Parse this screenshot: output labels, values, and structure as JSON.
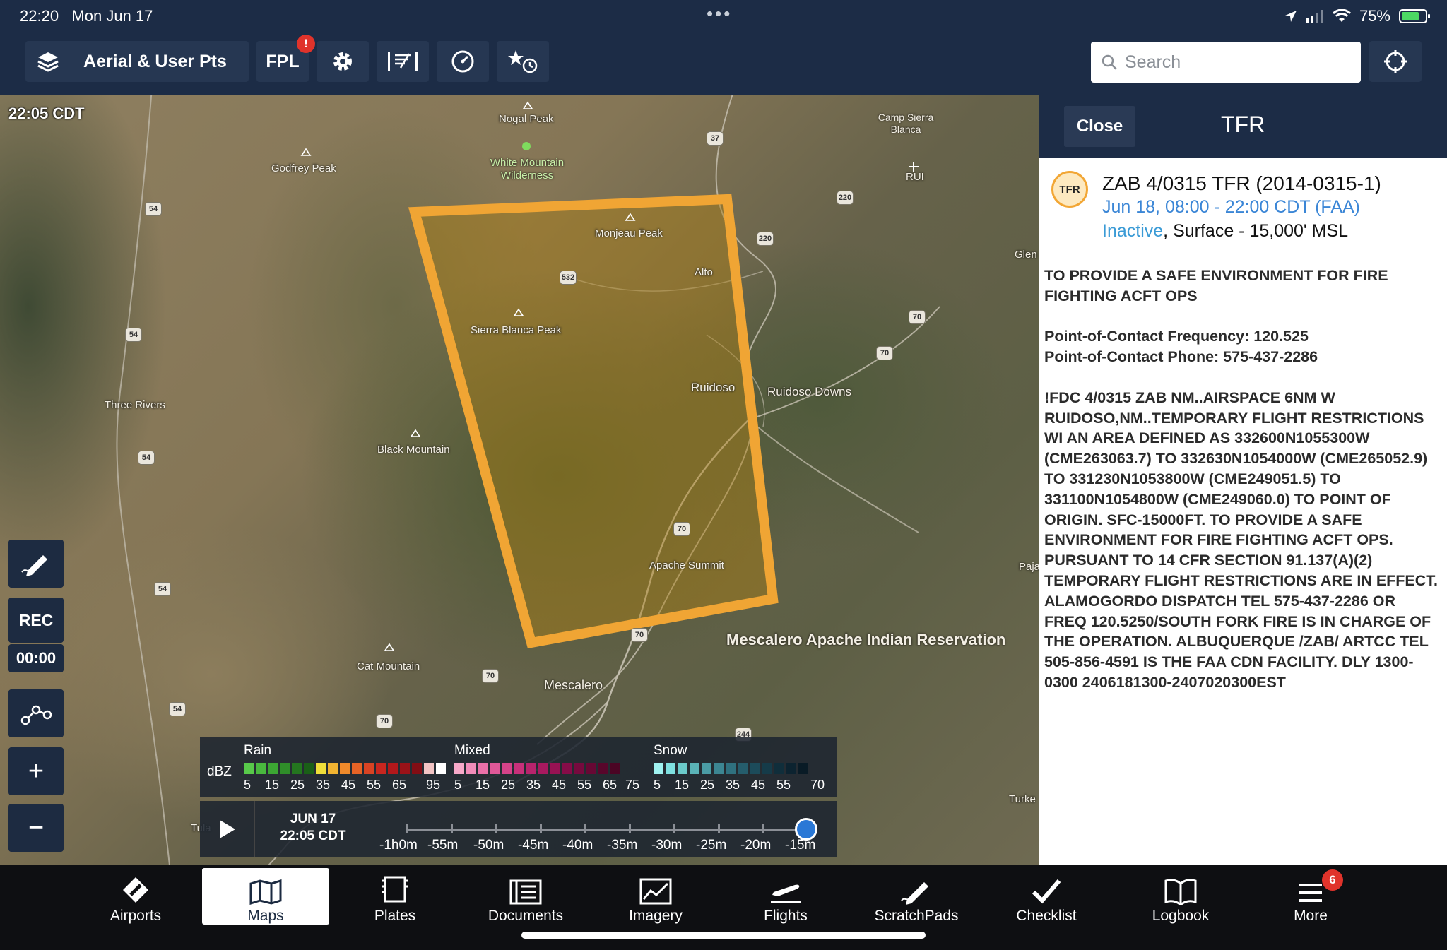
{
  "status_bar": {
    "time": "22:20",
    "date": "Mon Jun 17",
    "battery": "75%",
    "battery_level": 0.75
  },
  "toolbar": {
    "layer_label": "Aerial & User Pts",
    "fpl_label": "FPL",
    "fpl_badge": "!",
    "search_placeholder": "Search"
  },
  "map": {
    "timestamp": "22:05 CDT",
    "labels": [
      {
        "text": "Nogal Peak"
      },
      {
        "text": "White Mountain Wilderness"
      },
      {
        "text": "Godfrey Peak"
      },
      {
        "text": "Camp Sierra Blanca"
      },
      {
        "text": "RUI"
      },
      {
        "text": "Monjeau Peak"
      },
      {
        "text": "Alto"
      },
      {
        "text": "Sierra Blanca Peak"
      },
      {
        "text": "Ruidoso"
      },
      {
        "text": "Ruidoso Downs"
      },
      {
        "text": "Three Rivers"
      },
      {
        "text": "Black Mountain"
      },
      {
        "text": "Apache Summit"
      },
      {
        "text": "Cat Mountain"
      },
      {
        "text": "Mescalero"
      },
      {
        "text": "Glen"
      },
      {
        "text": "Paja"
      },
      {
        "text": "Turke"
      },
      {
        "text": "Tula"
      }
    ],
    "reservation_label": "Mescalero Apache Indian Reservation",
    "route_shields": [
      "37",
      "220",
      "220",
      "532",
      "70",
      "70",
      "70",
      "70",
      "70",
      "70",
      "54",
      "54",
      "54",
      "54",
      "54",
      "244"
    ]
  },
  "side_controls": {
    "rec_label": "REC",
    "rec_timer": "00:00",
    "zoom_in": "+",
    "zoom_out": "−"
  },
  "radar_legend": {
    "unit": "dBZ",
    "rain_label": "Rain",
    "mixed_label": "Mixed",
    "snow_label": "Snow",
    "rain_ticks": [
      "5",
      "15",
      "25",
      "35",
      "45",
      "55",
      "65",
      "95"
    ],
    "mixed_ticks": [
      "5",
      "15",
      "25",
      "35",
      "45",
      "55",
      "65",
      "75"
    ],
    "snow_ticks": [
      "5",
      "15",
      "25",
      "35",
      "45",
      "55",
      "70"
    ],
    "rain_colors": [
      "#58c94a",
      "#49b83e",
      "#3ca633",
      "#2f8d29",
      "#24761f",
      "#1a5f17",
      "#f0de3a",
      "#f2b431",
      "#ef8a2b",
      "#e66326",
      "#d94323",
      "#c8261f",
      "#b2181b",
      "#9a1218",
      "#820d14",
      "#f2c4c4",
      "#ffffff"
    ],
    "mixed_colors": [
      "#f7a9c9",
      "#f18cb9",
      "#ea70a8",
      "#e05898",
      "#d54389",
      "#c8307a",
      "#b8236c",
      "#a8195f",
      "#971253",
      "#860c48",
      "#760a3e",
      "#670834",
      "#58062b",
      "#4b0524"
    ],
    "snow_colors": [
      "#9ff2f0",
      "#7fe0e0",
      "#6bcaca",
      "#5ab3b7",
      "#4a9ca5",
      "#3c8692",
      "#2f717f",
      "#255d6c",
      "#1c4b5a",
      "#153b49",
      "#102e3b",
      "#0c2330",
      "#091b26"
    ]
  },
  "timeline": {
    "date": "JUN 17",
    "time": "22:05 CDT",
    "labels": [
      "-1h0m",
      "-55m",
      "-50m",
      "-45m",
      "-40m",
      "-35m",
      "-30m",
      "-25m",
      "-20m",
      "-15m"
    ],
    "position": 1.0
  },
  "tfr_panel": {
    "close_label": "Close",
    "title": "TFR",
    "icon_text": "TFR",
    "name": "ZAB 4/0315 TFR (2014-0315-1)",
    "time_range": "Jun 18, 08:00 - 22:00 CDT (FAA)",
    "status": "Inactive",
    "altitude": ", Surface - 15,000' MSL",
    "description": "TO PROVIDE A SAFE ENVIRONMENT FOR FIRE FIGHTING ACFT OPS\n\nPoint-of-Contact Frequency: 120.525\nPoint-of-Contact Phone: 575-437-2286\n\n!FDC 4/0315 ZAB NM..AIRSPACE 6NM W RUIDOSO,NM..TEMPORARY FLIGHT RESTRICTIONS WI AN AREA DEFINED AS 332600N1055300W (CME263063.7) TO 332630N1054000W (CME265052.9) TO 331230N1053800W (CME249051.5) TO 331100N1054800W (CME249060.0) TO POINT OF ORIGIN. SFC-15000FT. TO PROVIDE A SAFE ENVIRONMENT FOR FIRE FIGHTING ACFT OPS. PURSUANT TO 14 CFR SECTION 91.137(A)(2) TEMPORARY FLIGHT RESTRICTIONS ARE IN EFFECT. ALAMOGORDO DISPATCH TEL 575-437-2286 OR FREQ 120.5250/SOUTH FORK FIRE IS IN CHARGE OF THE OPERATION. ALBUQUERQUE /ZAB/ ARTCC TEL 505-856-4591 IS THE FAA CDN FACILITY. DLY 1300-0300 2406181300-2407020300EST"
  },
  "tabbar": {
    "tabs": [
      {
        "label": "Airports",
        "icon": "airports-icon"
      },
      {
        "label": "Maps",
        "icon": "maps-icon",
        "active": true
      },
      {
        "label": "Plates",
        "icon": "plates-icon"
      },
      {
        "label": "Documents",
        "icon": "documents-icon"
      },
      {
        "label": "Imagery",
        "icon": "imagery-icon"
      },
      {
        "label": "Flights",
        "icon": "flights-icon"
      },
      {
        "label": "ScratchPads",
        "icon": "scratchpads-icon"
      },
      {
        "label": "Checklist",
        "icon": "checklist-icon"
      },
      {
        "label": "Logbook",
        "icon": "logbook-icon"
      },
      {
        "label": "More",
        "icon": "more-icon"
      }
    ],
    "more_badge": "6"
  },
  "colors": {
    "tfr_border": "#f0a534",
    "tfr_fill": "rgba(176,128,20,0.45)",
    "accent_blue": "#3b86d6",
    "badge_red": "#e0332b"
  }
}
